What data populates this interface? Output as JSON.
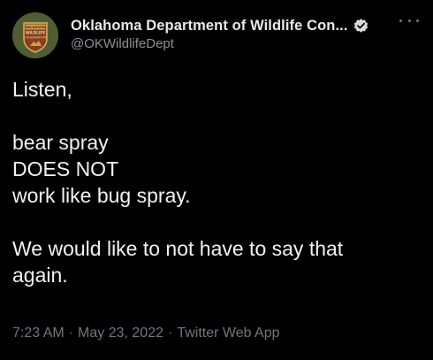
{
  "author": {
    "display_name": "Oklahoma Department of Wildlife Con...",
    "handle": "@OKWildlifeDept",
    "avatar_text_top": "OKLAHOMA",
    "avatar_text_mid": "WILDLIFE",
    "avatar_text_bottom": "CONSERVATION"
  },
  "icons": {
    "verified": "verified-badge-icon",
    "more": "more-options-icon",
    "avatar": "odwc-logo"
  },
  "tweet": {
    "lines": [
      "Listen,",
      "",
      "bear spray",
      "DOES NOT",
      "work like bug spray.",
      "",
      "We would like to not have to say that",
      "again."
    ]
  },
  "meta": {
    "time": "7:23 AM",
    "separator": "·",
    "date": "May 23, 2022",
    "source": "Twitter Web App"
  },
  "colors": {
    "background": "#000000",
    "primary_text": "#e7e9ea",
    "secondary_text": "#71767b",
    "verified_badge": "#d9d9d9"
  }
}
